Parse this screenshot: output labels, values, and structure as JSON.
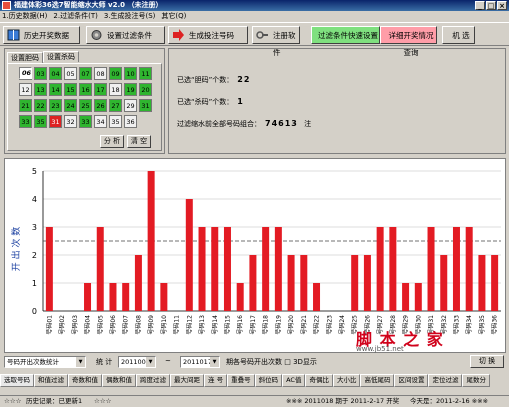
{
  "window": {
    "title": "福建体彩36选7智能缩水大师 v2.0 （未注册）",
    "buttons": [
      "_",
      "□",
      "×"
    ]
  },
  "menu": [
    "1.历史数据(H)",
    "2.过滤条件(T)",
    "3.生成投注号(S)",
    "其它(Q)"
  ],
  "toolbar": {
    "history_label": "历史开奖数据",
    "filter_label": "设置过滤条件",
    "generate_label": "生成投注号码",
    "register_label": "注册软件",
    "quick_label": "过滤条件快速设置",
    "detail_label": "详细开奖情况查询",
    "random_label": "机 选",
    "colors": {
      "quick_bg": "#7fe07f",
      "detail_bg": "#ff9da8"
    }
  },
  "number_panel": {
    "tab_dan": "设置胆码",
    "tab_sha": "设置杀码",
    "analyze_label": "分 析",
    "clear_label": "清 空",
    "numbers": [
      {
        "n": "01",
        "s": "sel"
      },
      {
        "n": "02",
        "s": ""
      },
      {
        "n": "03",
        "s": "g"
      },
      {
        "n": "04",
        "s": "g"
      },
      {
        "n": "05",
        "s": ""
      },
      {
        "n": "06",
        "s": "sel"
      },
      {
        "n": "07",
        "s": "g"
      },
      {
        "n": "08",
        "s": ""
      },
      {
        "n": "09",
        "s": "g"
      },
      {
        "n": "10",
        "s": "g"
      },
      {
        "n": "11",
        "s": "g"
      },
      {
        "n": "12",
        "s": ""
      },
      {
        "n": "13",
        "s": "g"
      },
      {
        "n": "14",
        "s": "g"
      },
      {
        "n": "15",
        "s": "g"
      },
      {
        "n": "16",
        "s": "g"
      },
      {
        "n": "17",
        "s": "g"
      },
      {
        "n": "18",
        "s": ""
      },
      {
        "n": "19",
        "s": "g"
      },
      {
        "n": "20",
        "s": "g"
      },
      {
        "n": "21",
        "s": "g"
      },
      {
        "n": "22",
        "s": "g"
      },
      {
        "n": "23",
        "s": "g"
      },
      {
        "n": "24",
        "s": "g"
      },
      {
        "n": "25",
        "s": "g"
      },
      {
        "n": "26",
        "s": "g"
      },
      {
        "n": "27",
        "s": "g"
      },
      {
        "n": "28",
        "s": "g"
      },
      {
        "n": "29",
        "s": ""
      },
      {
        "n": "30",
        "s": "g"
      },
      {
        "n": "31",
        "s": "g"
      },
      {
        "n": "32",
        "s": "g"
      },
      {
        "n": "33",
        "s": "g"
      },
      {
        "n": "34",
        "s": "g"
      },
      {
        "n": "35",
        "s": "g"
      },
      {
        "n": "36",
        "s": ""
      },
      {
        "n": "31",
        "s": "r"
      },
      {
        "n": "32",
        "s": ""
      },
      {
        "n": "33",
        "s": "g"
      },
      {
        "n": "34",
        "s": ""
      },
      {
        "n": "35",
        "s": ""
      },
      {
        "n": "36",
        "s": ""
      }
    ]
  },
  "info": {
    "dan_label": "已选“胆码”个数：",
    "dan_value": "22",
    "sha_label": "已选“杀码”个数：",
    "sha_value": "1",
    "total_label": "过滤缩水前全部号码组合：",
    "total_value": "74613",
    "total_unit": "注"
  },
  "chart_data": {
    "type": "bar",
    "ylabel": "开 出 次 数",
    "ylim": [
      0,
      5
    ],
    "yticks": [
      "0",
      "1",
      "2",
      "3",
      "4",
      "5"
    ],
    "reference_line": 2.5,
    "categories": [
      "号码01",
      "号码02",
      "号码03",
      "号码04",
      "号码05",
      "号码06",
      "号码07",
      "号码08",
      "号码09",
      "号码10",
      "号码11",
      "号码12",
      "号码13",
      "号码14",
      "号码15",
      "号码16",
      "号码17",
      "号码18",
      "号码19",
      "号码20",
      "号码21",
      "号码22",
      "号码23",
      "号码24",
      "号码25",
      "号码26",
      "号码27",
      "号码28",
      "号码29",
      "号码30",
      "号码31",
      "号码32",
      "号码33",
      "号码34",
      "号码35",
      "号码36"
    ],
    "values": [
      3,
      0,
      0,
      1,
      3,
      1,
      1,
      2,
      5,
      1,
      0,
      4,
      3,
      3,
      3,
      1,
      2,
      3,
      3,
      2,
      2,
      1,
      0,
      0,
      2,
      2,
      3,
      3,
      1,
      1,
      3,
      2,
      3,
      3,
      2,
      2
    ],
    "bar_color": "#e31b23"
  },
  "controls": {
    "stat_type": "号码开出次数统计",
    "stat_label": "统 计",
    "from_issue": "2011008",
    "tilde": "~",
    "to_issue": "2011017",
    "desc": "期各号码开出次数 □ 3D显示",
    "switch_label": "切 换"
  },
  "bottom_tabs": [
    "选取号码",
    "和值过滤",
    "奇数和值",
    "偶数和值",
    "跨度过滤",
    "最大间距",
    "连 号",
    "重叠号",
    "斜位码",
    "AC值",
    "奇偶比",
    "大小比",
    "高低尾码",
    "区间设置",
    "定位过滤",
    "尾数分"
  ],
  "status": {
    "history": "历史记录：已更新1",
    "stars": "☆☆☆",
    "reg": "※※※",
    "latest": "※※※ 2011018 期于 2011-2-17 开奖",
    "today": "今天是：2011-2-16 ※※※"
  },
  "watermark": {
    "text": "脚 本 之 家",
    "url": "www.jb51.net"
  }
}
